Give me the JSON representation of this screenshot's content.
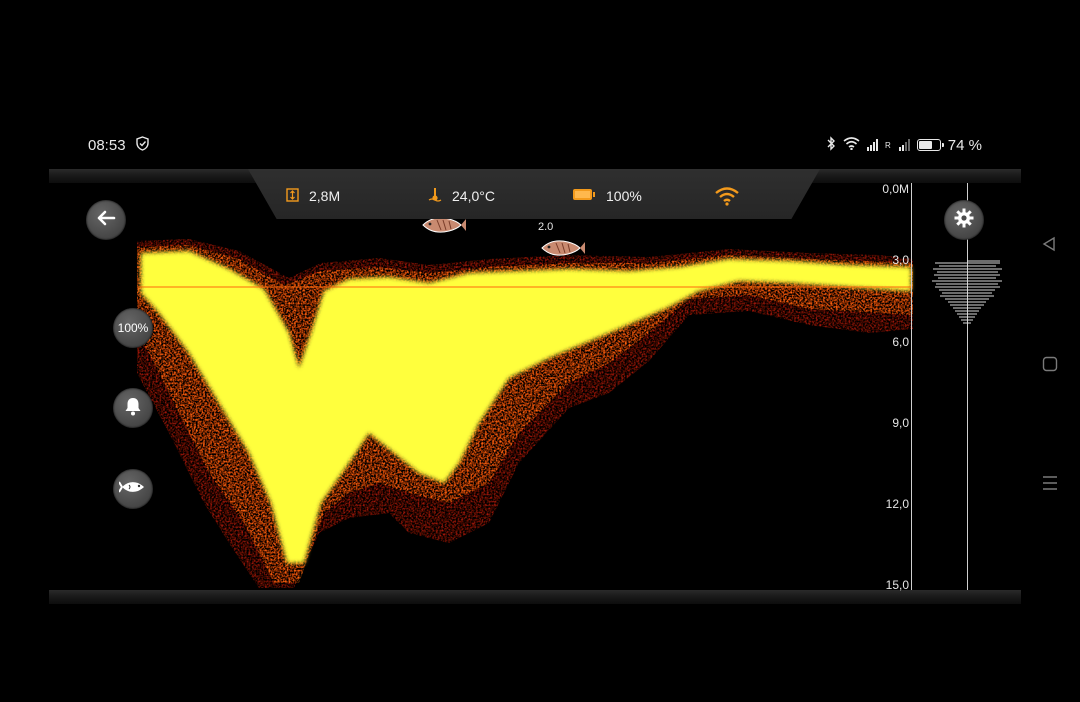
{
  "status_bar": {
    "time": "08:53",
    "roaming": "R",
    "battery_percent": "74 %",
    "battery_level": 0.74,
    "icons": [
      "vpn-shield-icon",
      "bluetooth-icon",
      "wifi-icon",
      "signal-icon",
      "battery-icon"
    ]
  },
  "info_bar": {
    "depth": "2,8M",
    "temperature": "24,0°C",
    "battery": "100%",
    "icons": [
      "depth-icon",
      "thermometer-icon",
      "device-battery-icon",
      "wifi-connection-icon"
    ],
    "accent": "#f39a1c"
  },
  "left_controls": {
    "sensitivity": "100%",
    "icons": [
      "back-arrow-icon",
      "bell-icon",
      "fish-icon"
    ]
  },
  "fish_markers": [
    {
      "depth_label": ""
    },
    {
      "depth_label": "2.0"
    }
  ],
  "depth_scale": {
    "unit_top": "0,0M",
    "labels": [
      "3,0",
      "6,0",
      "9,0",
      "12,0",
      "15,0"
    ],
    "max_depth": 15.0
  },
  "settings": {
    "icon": "gear-icon"
  },
  "colors": {
    "echo_strong": "#ffff44",
    "echo_mid": "#ff7a10",
    "echo_weak": "#b01808",
    "background": "#000000"
  }
}
